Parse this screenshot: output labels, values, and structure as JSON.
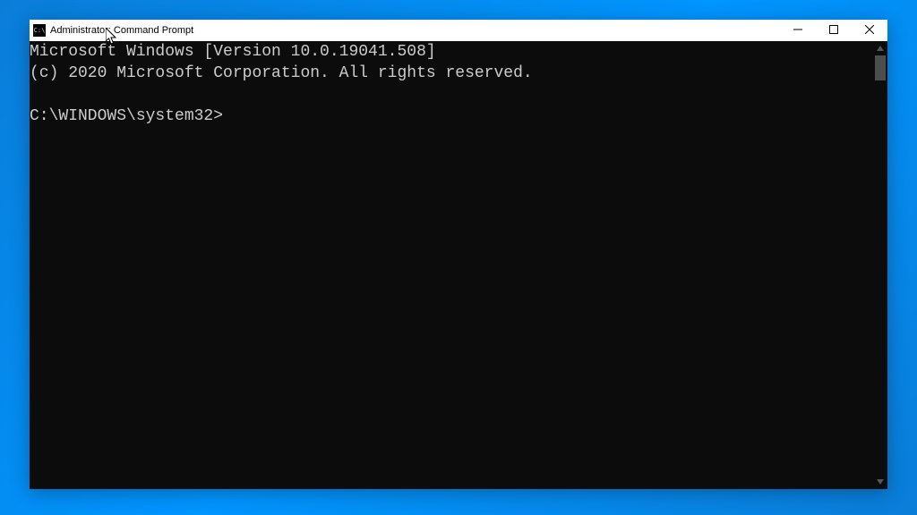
{
  "window": {
    "title": "Administrator: Command Prompt",
    "app_icon_text": "C:\\"
  },
  "console": {
    "line1": "Microsoft Windows [Version 10.0.19041.508]",
    "line2": "(c) 2020 Microsoft Corporation. All rights reserved.",
    "blank": "",
    "prompt": "C:\\WINDOWS\\system32>"
  }
}
